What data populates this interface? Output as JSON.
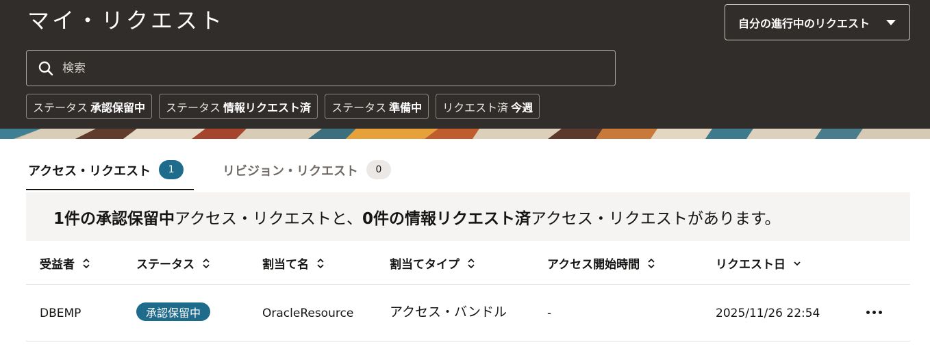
{
  "header": {
    "title": "マイ・リクエスト",
    "filter_dropdown": {
      "label": "自分の進行中のリクエスト"
    },
    "search": {
      "placeholder": "検索",
      "value": ""
    },
    "chips": [
      {
        "label": "ステータス",
        "value": "承認保留中"
      },
      {
        "label": "ステータス",
        "value": "情報リクエスト済"
      },
      {
        "label": "ステータス",
        "value": "準備中"
      },
      {
        "label": "リクエスト済",
        "value": "今週"
      }
    ]
  },
  "tabs": [
    {
      "label": "アクセス・リクエスト",
      "count": "1"
    },
    {
      "label": "リビジョン・リクエスト",
      "count": "0"
    }
  ],
  "summary": {
    "part1_bold": "1件の承認保留中",
    "part2": "アクセス・リクエストと、",
    "part3_bold": "0件の情報リクエスト済",
    "part4": "アクセス・リクエストがあります。"
  },
  "table": {
    "columns": [
      "受益者",
      "ステータス",
      "割当て名",
      "割当てタイプ",
      "アクセス開始時間",
      "リクエスト日"
    ],
    "rows": [
      {
        "beneficiary": "DBEMP",
        "status": "承認保留中",
        "assignment_name": "OracleResource",
        "assignment_type": "アクセス・バンドル",
        "access_start": "-",
        "request_date": "2025/11/26 22:54"
      }
    ]
  },
  "icons": {
    "search": "search-icon",
    "dropdown": "caret-down-icon",
    "sort": "sort-icon",
    "sort_desc": "chevron-down-icon",
    "more": "more-horizontal-icon"
  },
  "colors": {
    "header_bg": "#312d2a",
    "accent": "#1e6b8c",
    "summary_bg": "#f5f4f2"
  }
}
